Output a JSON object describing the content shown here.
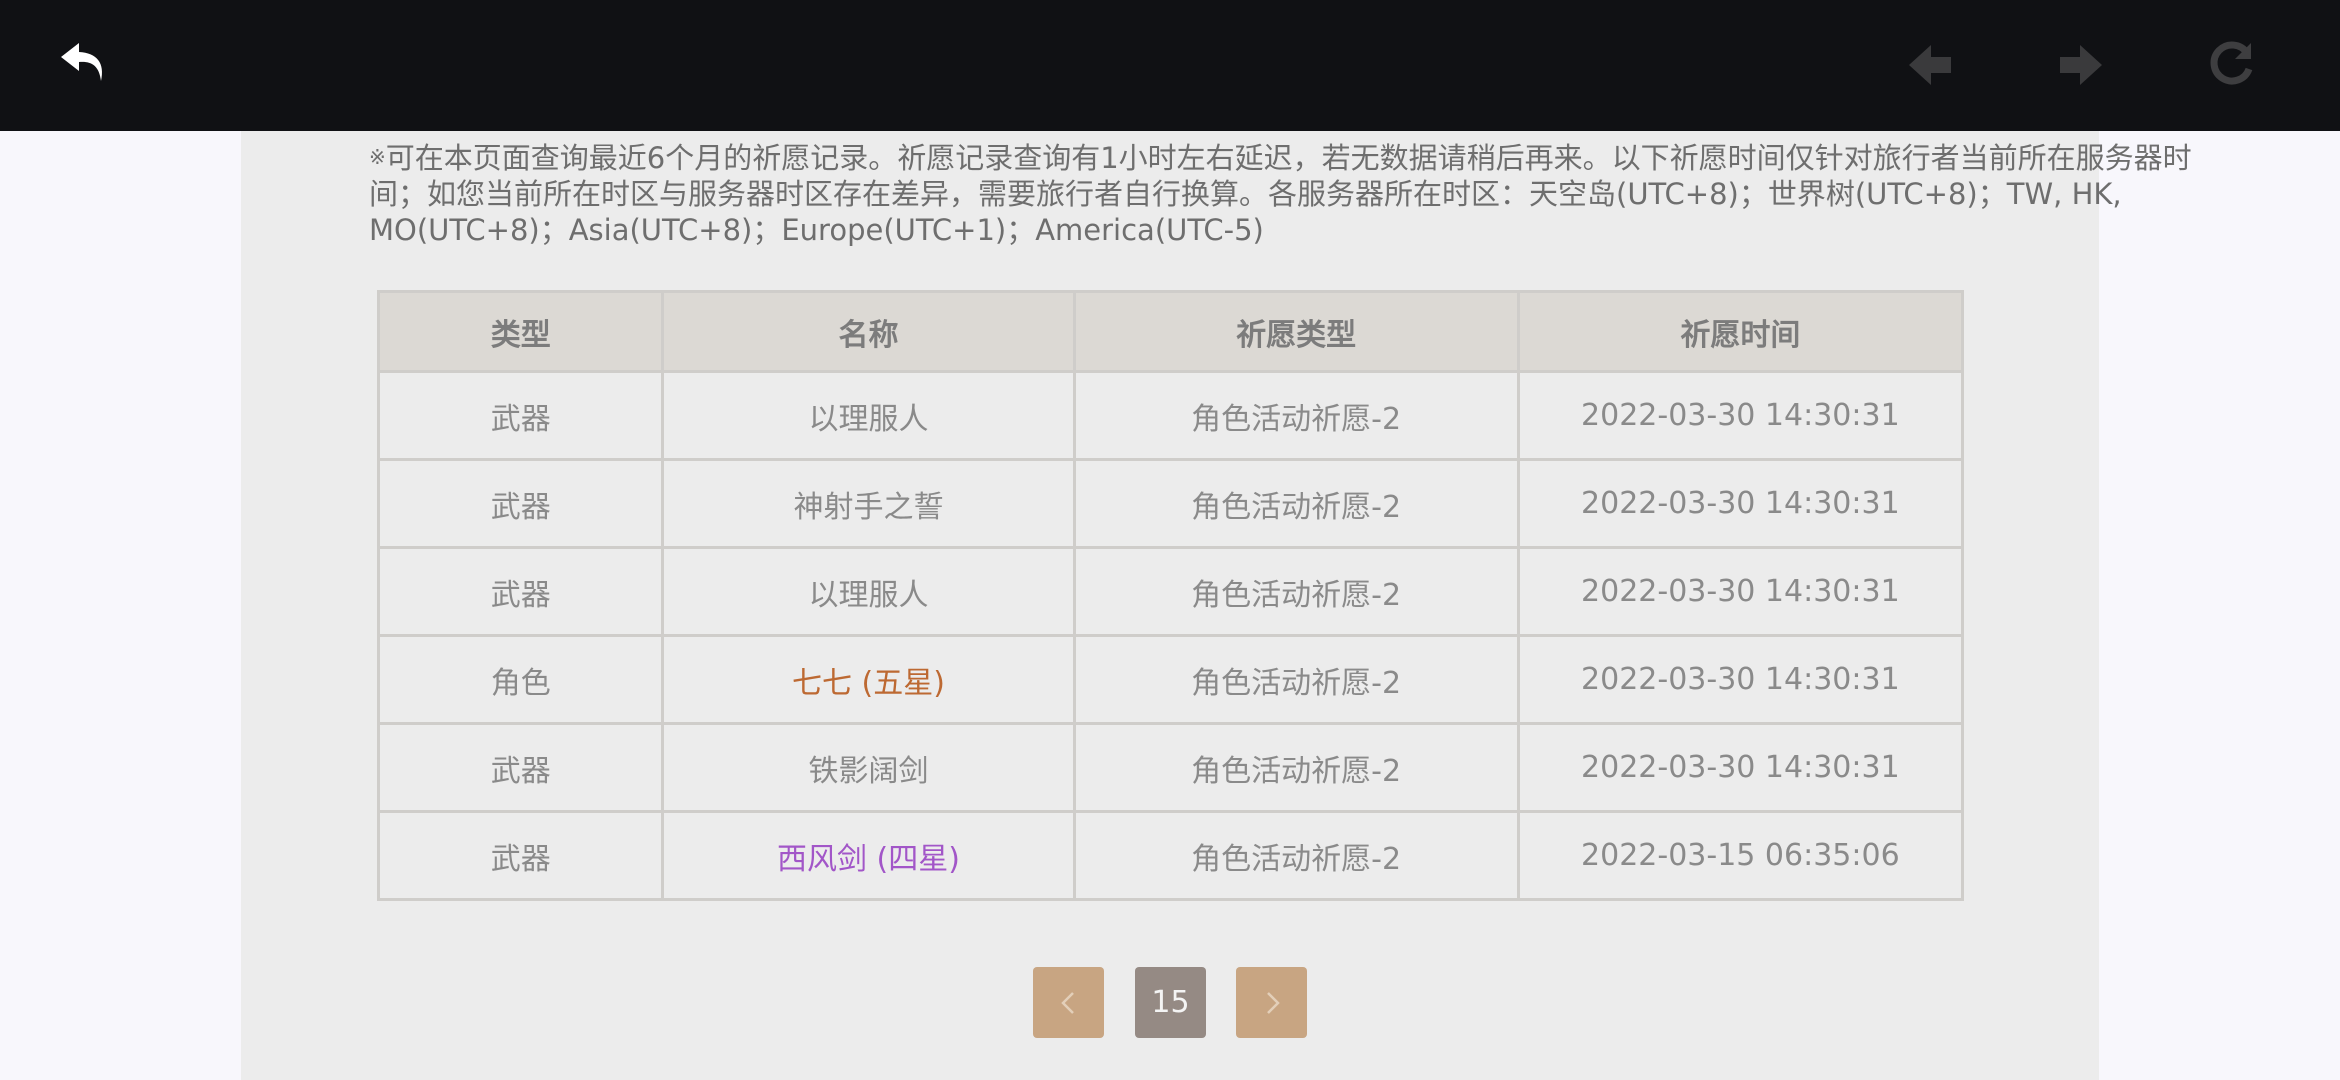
{
  "notice": {
    "mark": "※",
    "text": "可在本页面查询最近6个月的祈愿记录。祈愿记录查询有1小时左右延迟，若无数据请稍后再来。以下祈愿时间仅针对旅行者当前所在服务器时间；如您当前所在时区与服务器时区存在差异，需要旅行者自行换算。各服务器所在时区：天空岛(UTC+8)；世界树(UTC+8)；TW, HK, MO(UTC+8)；Asia(UTC+8)；Europe(UTC+1)；America(UTC-5)"
  },
  "table": {
    "headers": [
      "类型",
      "名称",
      "祈愿类型",
      "祈愿时间"
    ],
    "rows": [
      {
        "type": "武器",
        "name": "以理服人",
        "pool": "角色活动祈愿-2",
        "time": "2022-03-30 14:30:31",
        "rarity": "normal"
      },
      {
        "type": "武器",
        "name": "神射手之誓",
        "pool": "角色活动祈愿-2",
        "time": "2022-03-30 14:30:31",
        "rarity": "normal"
      },
      {
        "type": "武器",
        "name": "以理服人",
        "pool": "角色活动祈愿-2",
        "time": "2022-03-30 14:30:31",
        "rarity": "normal"
      },
      {
        "type": "角色",
        "name": "七七 (五星)",
        "pool": "角色活动祈愿-2",
        "time": "2022-03-30 14:30:31",
        "rarity": "five"
      },
      {
        "type": "武器",
        "name": "铁影阔剑",
        "pool": "角色活动祈愿-2",
        "time": "2022-03-30 14:30:31",
        "rarity": "normal"
      },
      {
        "type": "武器",
        "name": "西风剑 (四星)",
        "pool": "角色活动祈愿-2",
        "time": "2022-03-15 06:35:06",
        "rarity": "four"
      }
    ]
  },
  "pagination": {
    "current_page": "15"
  },
  "colors": {
    "five_star": "#bd6932",
    "four_star": "#a256c8",
    "pager_button": "#c8a582",
    "pager_current": "#958a84"
  },
  "icons": {
    "back": "back-arrow-icon",
    "prev": "diamond-left-icon",
    "next": "diamond-right-icon",
    "reload": "reload-icon",
    "pager_prev": "chevron-left-icon",
    "pager_next": "chevron-right-icon"
  }
}
